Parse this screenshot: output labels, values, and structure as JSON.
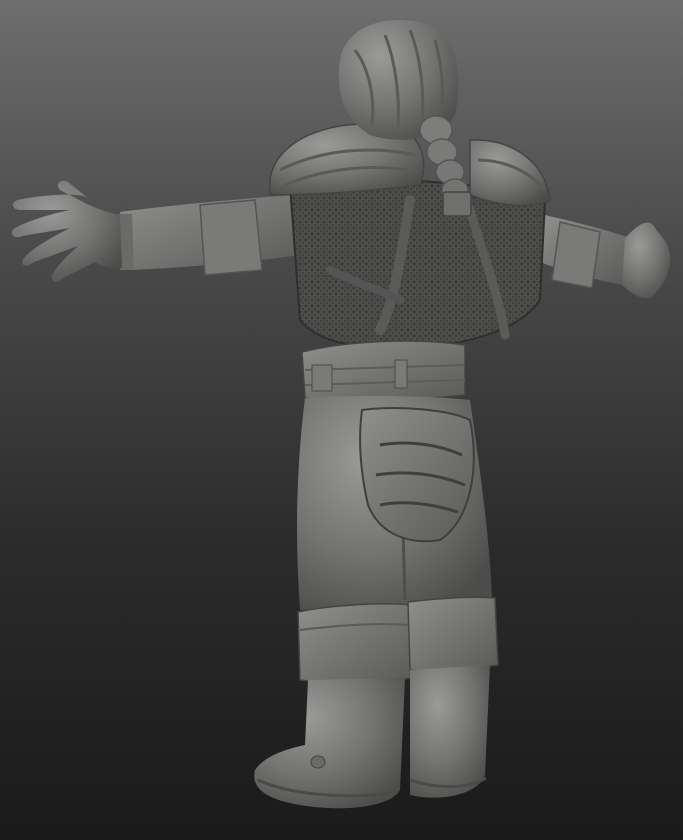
{
  "scene": {
    "subject_icon": "sculpt-figure-icon",
    "colors": {
      "bg_top": "#6e6e6e",
      "bg_bottom": "#1a1a1a",
      "clay_light": "#8a8a88",
      "clay_mid": "#6f6f6d",
      "clay_dark": "#4a4a48",
      "mail": "#3e3e3c"
    }
  }
}
